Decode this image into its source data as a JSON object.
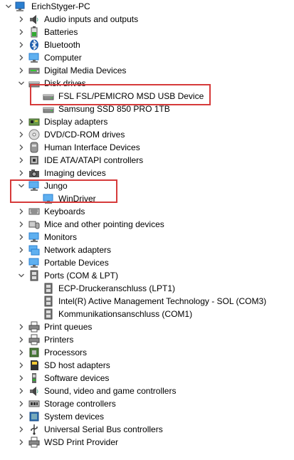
{
  "colors": {
    "highlight": "#d63a3a",
    "chevron": "#555555",
    "monitor_blue": "#2a7fd0",
    "drive_gray": "#8a8a8a"
  },
  "tree": [
    {
      "label": "ErichStyger-PC",
      "level": 0,
      "expander": "expanded",
      "icon": "computer-icon"
    },
    {
      "label": "Audio inputs and outputs",
      "level": 1,
      "expander": "collapsed",
      "icon": "speaker-icon"
    },
    {
      "label": "Batteries",
      "level": 1,
      "expander": "collapsed",
      "icon": "battery-icon"
    },
    {
      "label": "Bluetooth",
      "level": 1,
      "expander": "collapsed",
      "icon": "bluetooth-icon"
    },
    {
      "label": "Computer",
      "level": 1,
      "expander": "collapsed",
      "icon": "monitor-icon"
    },
    {
      "label": "Digital Media Devices",
      "level": 1,
      "expander": "collapsed",
      "icon": "media-device-icon"
    },
    {
      "label": "Disk drives",
      "level": 1,
      "expander": "expanded",
      "icon": "disk-drive-icon"
    },
    {
      "label": "FSL FSL/PEMICRO MSD USB Device",
      "level": 2,
      "expander": "none",
      "icon": "disk-drive-icon"
    },
    {
      "label": "Samsung SSD 850 PRO 1TB",
      "level": 2,
      "expander": "none",
      "icon": "disk-drive-icon"
    },
    {
      "label": "Display adapters",
      "level": 1,
      "expander": "collapsed",
      "icon": "display-adapter-icon"
    },
    {
      "label": "DVD/CD-ROM drives",
      "level": 1,
      "expander": "collapsed",
      "icon": "dvd-drive-icon"
    },
    {
      "label": "Human Interface Devices",
      "level": 1,
      "expander": "collapsed",
      "icon": "hid-icon"
    },
    {
      "label": "IDE ATA/ATAPI controllers",
      "level": 1,
      "expander": "collapsed",
      "icon": "ide-controller-icon"
    },
    {
      "label": "Imaging devices",
      "level": 1,
      "expander": "collapsed",
      "icon": "camera-icon"
    },
    {
      "label": "Jungo",
      "level": 1,
      "expander": "expanded",
      "icon": "monitor-icon"
    },
    {
      "label": "WinDriver",
      "level": 2,
      "expander": "none",
      "icon": "monitor-icon"
    },
    {
      "label": "Keyboards",
      "level": 1,
      "expander": "collapsed",
      "icon": "keyboard-icon"
    },
    {
      "label": "Mice and other pointing devices",
      "level": 1,
      "expander": "collapsed",
      "icon": "mouse-icon"
    },
    {
      "label": "Monitors",
      "level": 1,
      "expander": "collapsed",
      "icon": "monitor-icon"
    },
    {
      "label": "Network adapters",
      "level": 1,
      "expander": "collapsed",
      "icon": "network-adapter-icon"
    },
    {
      "label": "Portable Devices",
      "level": 1,
      "expander": "collapsed",
      "icon": "monitor-icon"
    },
    {
      "label": "Ports (COM & LPT)",
      "level": 1,
      "expander": "expanded",
      "icon": "port-icon"
    },
    {
      "label": "ECP-Druckeranschluss (LPT1)",
      "level": 2,
      "expander": "none",
      "icon": "port-icon"
    },
    {
      "label": "Intel(R) Active Management Technology - SOL (COM3)",
      "level": 2,
      "expander": "none",
      "icon": "port-icon"
    },
    {
      "label": "Kommunikationsanschluss (COM1)",
      "level": 2,
      "expander": "none",
      "icon": "port-icon"
    },
    {
      "label": "Print queues",
      "level": 1,
      "expander": "collapsed",
      "icon": "printer-icon"
    },
    {
      "label": "Printers",
      "level": 1,
      "expander": "collapsed",
      "icon": "printer-icon"
    },
    {
      "label": "Processors",
      "level": 1,
      "expander": "collapsed",
      "icon": "processor-icon"
    },
    {
      "label": "SD host adapters",
      "level": 1,
      "expander": "collapsed",
      "icon": "sd-card-icon"
    },
    {
      "label": "Software devices",
      "level": 1,
      "expander": "collapsed",
      "icon": "software-device-icon"
    },
    {
      "label": "Sound, video and game controllers",
      "level": 1,
      "expander": "collapsed",
      "icon": "speaker-icon"
    },
    {
      "label": "Storage controllers",
      "level": 1,
      "expander": "collapsed",
      "icon": "storage-controller-icon"
    },
    {
      "label": "System devices",
      "level": 1,
      "expander": "collapsed",
      "icon": "system-device-icon"
    },
    {
      "label": "Universal Serial Bus controllers",
      "level": 1,
      "expander": "collapsed",
      "icon": "usb-icon"
    },
    {
      "label": "WSD Print Provider",
      "level": 1,
      "expander": "collapsed",
      "icon": "printer-icon"
    }
  ]
}
